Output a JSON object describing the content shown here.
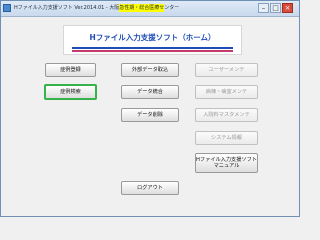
{
  "window": {
    "title": "Hファイル入力支援ソフト Ver.2014.01 - 大阪急性期・総合医療センター"
  },
  "window_controls": {
    "minimize": "–",
    "maximize": "□",
    "close": "×"
  },
  "banner": {
    "title": "Hファイル入力支援ソフト（ホーム）"
  },
  "buttons": {
    "case_register": "症例登録",
    "external_import": "外部データ取込",
    "user_maintenance": "ユーザーメンテ",
    "case_search": "症例検索",
    "data_merge": "データ統合",
    "ward_maintenance": "病棟・病室メンテ",
    "data_delete": "データ削除",
    "admission_master": "入院料マスタメンテ",
    "system_info": "システム情報",
    "manual_line1": "Hファイル入力支援ソフト",
    "manual_line2": "マニュアル",
    "logout": "ログアウト"
  }
}
